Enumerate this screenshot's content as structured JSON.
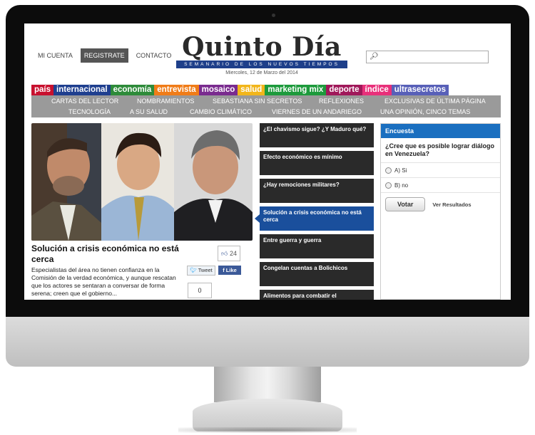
{
  "header": {
    "topnav": [
      "MI CUENTA",
      "REGISTRATE",
      "CONTACTO"
    ],
    "logo_title": "Quinto Día",
    "logo_subtitle": "SEMANARIO DE LOS NUEVOS TIEMPOS",
    "date": "Miercoles, 12 de Marzo del 2014",
    "search_placeholder": ""
  },
  "categories": [
    {
      "label": "país",
      "color": "#c8102e"
    },
    {
      "label": "internacional",
      "color": "#1f3f8f"
    },
    {
      "label": "economía",
      "color": "#2e8b3a"
    },
    {
      "label": "entrevista",
      "color": "#f07c18"
    },
    {
      "label": "mosaico",
      "color": "#7a2b8f"
    },
    {
      "label": "salud",
      "color": "#f2b61b"
    },
    {
      "label": "marketing mix",
      "color": "#1d9a3c"
    },
    {
      "label": "deporte",
      "color": "#a0185a"
    },
    {
      "label": "índice",
      "color": "#e8307a"
    },
    {
      "label": "ultrasecretos",
      "color": "#5860b8"
    }
  ],
  "subnav": {
    "row1": [
      "CARTAS DEL LECTOR",
      "NOMBRAMIENTOS",
      "SEBASTIANA SIN SECRETOS",
      "REFLEXIONES",
      "EXCLUSIVAS DE ÚLTIMA PÁGINA"
    ],
    "row2": [
      "TECNOLOGÍA",
      "A SU SALUD",
      "CAMBIO CLIMÁTICO",
      "VIERNES DE UN ANDARIEGO",
      "UNA OPINIÓN, CINCO TEMAS"
    ]
  },
  "featured": {
    "headline": "Solución a crisis económica no está cerca",
    "summary": "Especialistas del área no tienen confianza en la Comisión de la verdad económica, y aunque rescatan que los actores se sentaran a conversar de forma serena; creen que el gobierno...",
    "likes": "24",
    "tweet_label": "Tweet",
    "like_label": "Like",
    "comments": "0"
  },
  "articles": [
    "¿El chavismo sigue? ¿Y Maduro qué?",
    "Efecto económico es mínimo",
    "¿Hay remociones militares?",
    "Solución a crisis económica no está cerca",
    "Entre guerra y guerra",
    "Congelan cuentas a Bolichicos",
    "Alimentos para combatir el"
  ],
  "poll": {
    "title": "Encuesta",
    "question": "¿Cree que es posible lograr diálogo en Venezuela?",
    "options": [
      "A) Si",
      "B) no"
    ],
    "vote_label": "Votar",
    "results_label": "Ver Resultados"
  }
}
